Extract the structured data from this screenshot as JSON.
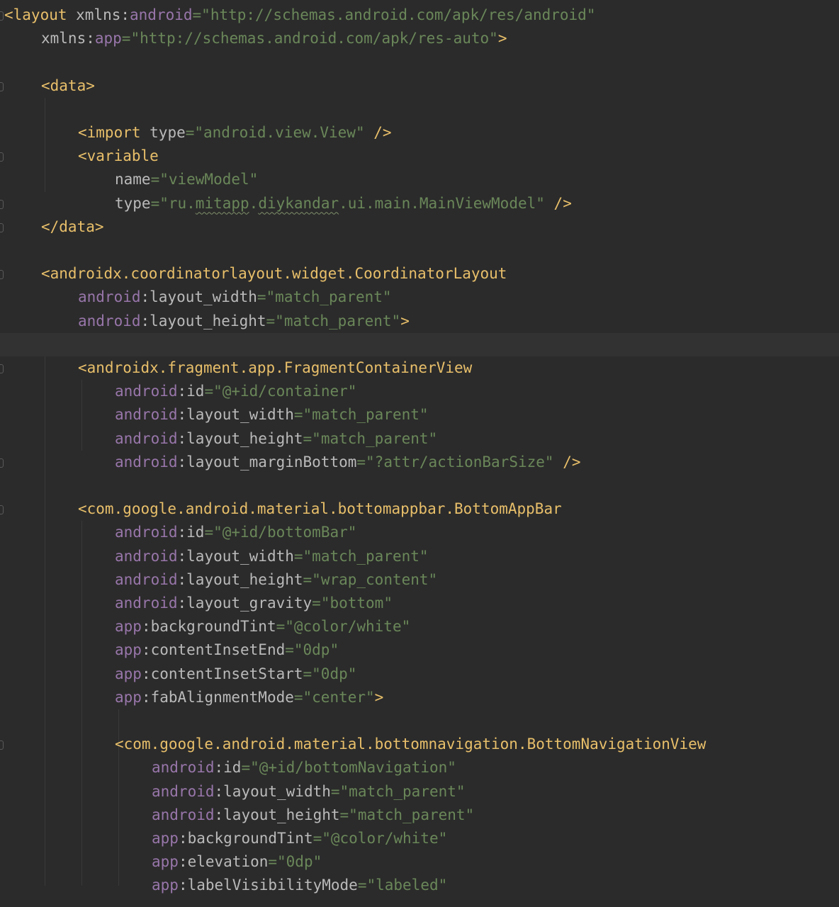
{
  "editor": {
    "language": "XML",
    "theme": "Darcula",
    "colors": {
      "background": "#2b2b2b",
      "tag": "#e8bf6a",
      "attribute": "#bababa",
      "namespace": "#9876aa",
      "string": "#6a8759",
      "plain": "#a9b7c6",
      "current_line": "#323232"
    },
    "lines": [
      [
        {
          "t": "<layout ",
          "c": "tag"
        },
        {
          "t": "xmlns:",
          "c": "attr"
        },
        {
          "t": "android",
          "c": "ns"
        },
        {
          "t": "=\"http://schemas.android.com/apk/res/android\"",
          "c": "val"
        }
      ],
      [
        {
          "t": "xmlns:",
          "c": "attr"
        },
        {
          "t": "app",
          "c": "ns"
        },
        {
          "t": "=\"http://schemas.android.com/apk/res-auto\"",
          "c": "val"
        },
        {
          "t": ">",
          "c": "tag"
        }
      ],
      [],
      [
        {
          "t": "<data>",
          "c": "tag"
        }
      ],
      [],
      [
        {
          "t": "<import ",
          "c": "tag"
        },
        {
          "t": "type",
          "c": "attr"
        },
        {
          "t": "=\"android.view.View\" ",
          "c": "val"
        },
        {
          "t": "/>",
          "c": "tag"
        }
      ],
      [
        {
          "t": "<variable",
          "c": "tag"
        }
      ],
      [
        {
          "t": "name",
          "c": "attr"
        },
        {
          "t": "=\"viewModel\"",
          "c": "val"
        }
      ],
      [
        {
          "t": "type",
          "c": "attr"
        },
        {
          "t": "=\"ru.",
          "c": "val"
        },
        {
          "t": "mitapp",
          "c": "val typo"
        },
        {
          "t": ".",
          "c": "val"
        },
        {
          "t": "diykandar",
          "c": "val typo"
        },
        {
          "t": ".ui.main.MainViewModel\" ",
          "c": "val"
        },
        {
          "t": "/>",
          "c": "tag"
        }
      ],
      [
        {
          "t": "</data>",
          "c": "tag"
        }
      ],
      [],
      [
        {
          "t": "<androidx.coordinatorlayout.widget.CoordinatorLayout",
          "c": "tag"
        }
      ],
      [
        {
          "t": "android",
          "c": "ns"
        },
        {
          "t": ":layout_width",
          "c": "attr"
        },
        {
          "t": "=\"match_parent\"",
          "c": "val"
        }
      ],
      [
        {
          "t": "android",
          "c": "ns"
        },
        {
          "t": ":layout_height",
          "c": "attr"
        },
        {
          "t": "=\"match_parent\"",
          "c": "val"
        },
        {
          "t": ">",
          "c": "tag"
        }
      ],
      [],
      [
        {
          "t": "<androidx.fragment.app.FragmentContainerView",
          "c": "tag"
        }
      ],
      [
        {
          "t": "android",
          "c": "ns"
        },
        {
          "t": ":id",
          "c": "attr"
        },
        {
          "t": "=\"@+id/container\"",
          "c": "val"
        }
      ],
      [
        {
          "t": "android",
          "c": "ns"
        },
        {
          "t": ":layout_width",
          "c": "attr"
        },
        {
          "t": "=\"match_parent\"",
          "c": "val"
        }
      ],
      [
        {
          "t": "android",
          "c": "ns"
        },
        {
          "t": ":layout_height",
          "c": "attr"
        },
        {
          "t": "=\"match_parent\"",
          "c": "val"
        }
      ],
      [
        {
          "t": "android",
          "c": "ns"
        },
        {
          "t": ":layout_marginBottom",
          "c": "attr"
        },
        {
          "t": "=\"?attr/actionBarSize\" ",
          "c": "val"
        },
        {
          "t": "/>",
          "c": "tag"
        }
      ],
      [],
      [
        {
          "t": "<com.google.android.material.bottomappbar.BottomAppBar",
          "c": "tag"
        }
      ],
      [
        {
          "t": "android",
          "c": "ns"
        },
        {
          "t": ":id",
          "c": "attr"
        },
        {
          "t": "=\"@+id/bottomBar\"",
          "c": "val"
        }
      ],
      [
        {
          "t": "android",
          "c": "ns"
        },
        {
          "t": ":layout_width",
          "c": "attr"
        },
        {
          "t": "=\"match_parent\"",
          "c": "val"
        }
      ],
      [
        {
          "t": "android",
          "c": "ns"
        },
        {
          "t": ":layout_height",
          "c": "attr"
        },
        {
          "t": "=\"wrap_content\"",
          "c": "val"
        }
      ],
      [
        {
          "t": "android",
          "c": "ns"
        },
        {
          "t": ":layout_gravity",
          "c": "attr"
        },
        {
          "t": "=\"bottom\"",
          "c": "val"
        }
      ],
      [
        {
          "t": "app",
          "c": "ns"
        },
        {
          "t": ":backgroundTint",
          "c": "attr"
        },
        {
          "t": "=\"@color/white\"",
          "c": "val"
        }
      ],
      [
        {
          "t": "app",
          "c": "ns"
        },
        {
          "t": ":contentInsetEnd",
          "c": "attr"
        },
        {
          "t": "=\"0dp\"",
          "c": "val"
        }
      ],
      [
        {
          "t": "app",
          "c": "ns"
        },
        {
          "t": ":contentInsetStart",
          "c": "attr"
        },
        {
          "t": "=\"0dp\"",
          "c": "val"
        }
      ],
      [
        {
          "t": "app",
          "c": "ns"
        },
        {
          "t": ":fabAlignmentMode",
          "c": "attr"
        },
        {
          "t": "=\"center\"",
          "c": "val"
        },
        {
          "t": ">",
          "c": "tag"
        }
      ],
      [],
      [
        {
          "t": "<com.google.android.material.bottomnavigation.BottomNavigationView",
          "c": "tag"
        }
      ],
      [
        {
          "t": "android",
          "c": "ns"
        },
        {
          "t": ":id",
          "c": "attr"
        },
        {
          "t": "=\"@+id/bottomNavigation\"",
          "c": "val"
        }
      ],
      [
        {
          "t": "android",
          "c": "ns"
        },
        {
          "t": ":layout_width",
          "c": "attr"
        },
        {
          "t": "=\"match_parent\"",
          "c": "val"
        }
      ],
      [
        {
          "t": "android",
          "c": "ns"
        },
        {
          "t": ":layout_height",
          "c": "attr"
        },
        {
          "t": "=\"match_parent\"",
          "c": "val"
        }
      ],
      [
        {
          "t": "app",
          "c": "ns"
        },
        {
          "t": ":backgroundTint",
          "c": "attr"
        },
        {
          "t": "=\"@color/white\"",
          "c": "val"
        }
      ],
      [
        {
          "t": "app",
          "c": "ns"
        },
        {
          "t": ":elevation",
          "c": "attr"
        },
        {
          "t": "=\"0dp\"",
          "c": "val"
        }
      ],
      [
        {
          "t": "app",
          "c": "ns"
        },
        {
          "t": ":labelVisibilityMode",
          "c": "attr"
        },
        {
          "t": "=\"labeled\"",
          "c": "val"
        }
      ]
    ]
  }
}
